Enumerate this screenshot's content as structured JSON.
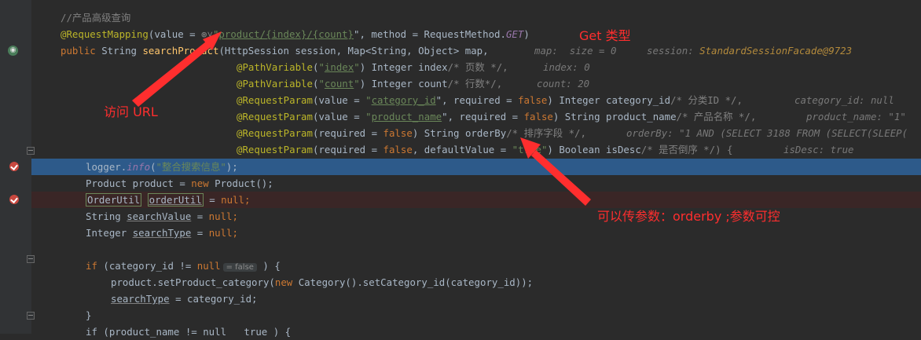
{
  "code": {
    "comment_title": "//产品高级查询",
    "mapping_anno": "@RequestMapping",
    "value_eq": "(value = ",
    "url": "product/{index}/{count}",
    "method_part": "\", method = RequestMethod.",
    "method_get": "GET",
    "sig_public": "public",
    "sig_string": " String ",
    "sig_fn": "searchProduct",
    "sig_rest": "(HttpSession session, Map<String, Object> map,",
    "hint_map": "map:  size = 0",
    "hint_session_label": "session: ",
    "hint_session_value": "StandardSessionFacade@9723",
    "pv_anno": "@PathVariable",
    "pv_index": "index",
    "pv_index_rest": ") Integer index",
    "pv_index_cm": "/* 页数 */,",
    "hint_index": "index: 0",
    "pv_count": "count",
    "pv_count_rest": ") Integer count",
    "pv_count_cm": "/* 行数*/,",
    "hint_count": "count: 20",
    "rp_anno": "@RequestParam",
    "rp_value": "(value = ",
    "rp_cat": "category_id",
    "rp_req": "\", required = ",
    "kw_false": "false",
    "rp_cat_rest": ") Integer category_id",
    "rp_cat_cm": "/* 分类ID */,",
    "hint_cat": "category_id: null",
    "rp_pname": "product_name",
    "rp_pname_rest": ") String product_name",
    "rp_pname_cm": "/* 产品名称 */,",
    "hint_pname": "product_name: \"1\"",
    "rp_required": "(required = ",
    "rp_order_rest": ") String orderBy",
    "rp_order_cm": "/* 排序字段 */,",
    "hint_order": "orderBy: \"1 AND (SELECT 3188 FROM (SELECT(SLEEP(",
    "rp_isdesc_mid": ", defaultValue = ",
    "rp_isdesc_val": "\"true\"",
    "rp_isdesc_rest": ") Boolean isDesc",
    "rp_isdesc_cm": "/* 是否倒序 */) {",
    "hint_isdesc": "isDesc: true",
    "logger": "logger.",
    "logger_fn": "info",
    "logger_arg": "\"整合搜索信息\"",
    "logger_end": ");",
    "prod_decl": "Product product = ",
    "kw_new": "new",
    "prod_ctor": " Product();",
    "ou_type": "OrderUtil",
    "ou_var": "orderUtil",
    "eq_null": " = ",
    "kw_null": "null",
    "semi": ";",
    "sv_type": "String ",
    "sv_var": "searchValue",
    "st_type": "Integer ",
    "st_var": "searchType",
    "kw_if": "if",
    "if_cond": " (category_id != ",
    "inlay_false": "= false",
    "if_close": " ) {",
    "set_cat": "product.setProduct_category(",
    "set_cat_rest": " Category().setCategory_id(category_id));",
    "st_assign": " = category_id;",
    "close_brace": "}",
    "last_line": "if (product_name != null   true ) {"
  },
  "annotations": {
    "get_type": "Get 类型",
    "visit_url": "访问 URL",
    "param_note": "可以传参数：orderby  ;参数可控"
  },
  "colors": {
    "annotation_red": "#ff2e2e",
    "editor_bg": "#2b2b2b",
    "selected_line": "#2d5a8a"
  }
}
